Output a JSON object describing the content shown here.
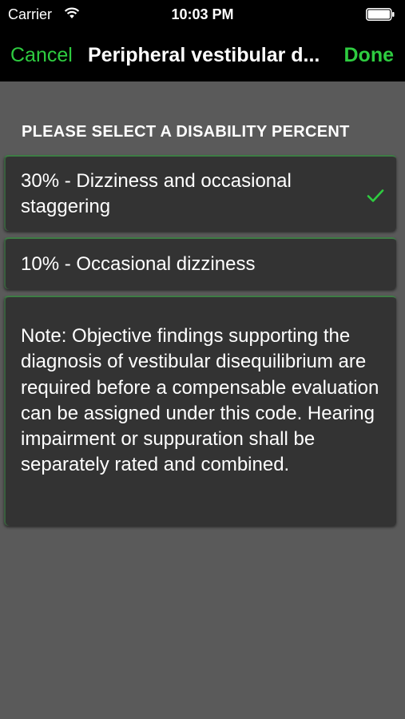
{
  "status_bar": {
    "carrier": "Carrier",
    "time": "10:03 PM",
    "wifi_icon": "wifi-icon",
    "battery_icon": "battery-icon"
  },
  "nav": {
    "cancel_label": "Cancel",
    "title": "Peripheral vestibular d...",
    "done_label": "Done"
  },
  "section_header": "PLEASE SELECT A DISABILITY PERCENT",
  "options": [
    {
      "label": "30% - Dizziness and occasional staggering",
      "selected": true
    },
    {
      "label": "10% - Occasional dizziness",
      "selected": false
    }
  ],
  "note": "Note: Objective findings supporting the diagnosis of vestibular disequilibrium are required before a compensable evaluation can be assigned under this code. Hearing impairment or suppuration shall be separately rated and combined.",
  "colors": {
    "accent": "#2ecc40",
    "background": "#5a5a5a",
    "card": "#333333",
    "bar": "#000000"
  }
}
